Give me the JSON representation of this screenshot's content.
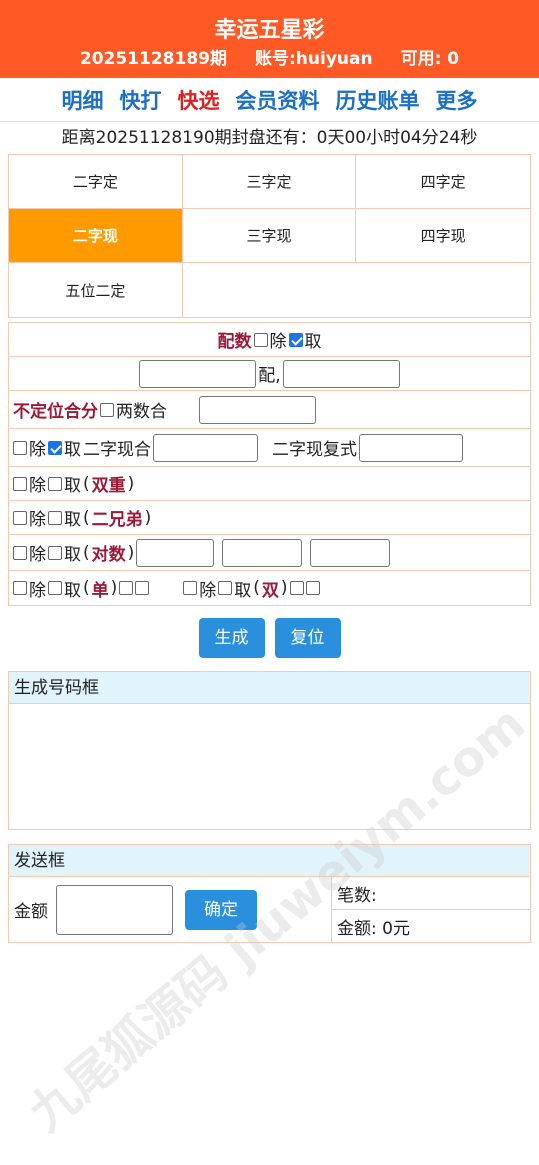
{
  "header": {
    "title": "幸运五星彩",
    "period": "20251128189期",
    "account": "账号:huiyuan",
    "balance": "可用: 0"
  },
  "nav": [
    "明细",
    "快打",
    "快选",
    "会员资料",
    "历史账单",
    "更多"
  ],
  "countdown": "距离20251128190期封盘还有：0天00小时04分24秒",
  "tabs": [
    "二字定",
    "三字定",
    "四字定",
    "二字现",
    "三字现",
    "四字现",
    "五位二定"
  ],
  "options": {
    "peishu": "配数",
    "exclude": "除",
    "take": "取",
    "pei": "配,",
    "budingwei": "不定位合分",
    "two_sum": "两数合",
    "erzixian_he": "二字现合",
    "erzixian_fushi": "二字现复式",
    "shuangchong": "双重",
    "erxiongdi": "二兄弟",
    "duishu": "对数",
    "dan": "单",
    "shuang": "双"
  },
  "buttons": {
    "generate": "生成",
    "reset": "复位"
  },
  "gen_box_label": "生成号码框",
  "send": {
    "label": "发送框",
    "amount_label": "金额",
    "confirm": "确定",
    "count_label": "笔数:",
    "total_label": "金额:",
    "total_value": "0元"
  },
  "watermark": "九尾狐源码 jiuweiym.com",
  "colors": {
    "header": "#ff5a26",
    "nav": "#1b6fc4",
    "nav_active": "#e02020",
    "tab_active": "#ff9b00",
    "button": "#2a8fdc"
  }
}
